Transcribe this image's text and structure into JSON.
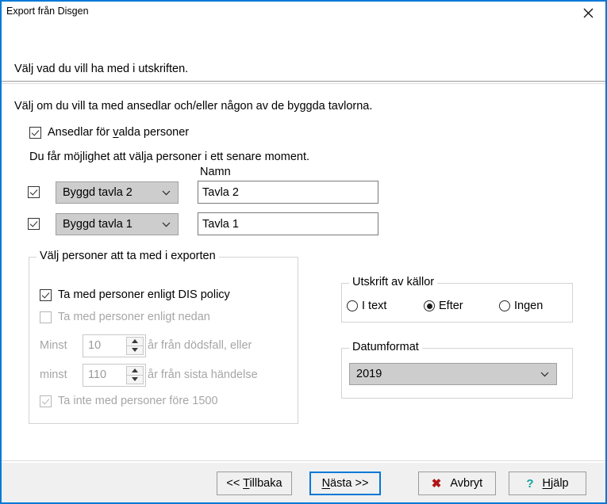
{
  "window": {
    "title": "Export från Disgen",
    "close_icon": "close-icon",
    "border_color": "#0078d7"
  },
  "header": {
    "instruction": "Välj vad du vill ha med i utskriften."
  },
  "main": {
    "intro": "Välj om du vill ta med ansedlar och/eller någon av de byggda tavlorna.",
    "ansedlar_checkbox": {
      "label_pre": "Ansedlar för ",
      "accel": "v",
      "label_post": "alda personer",
      "checked": true
    },
    "note": "Du får möjlighet att välja personer i ett senare moment.",
    "namn_column_label": "Namn",
    "tavlor": [
      {
        "checked": true,
        "combo_value": "Byggd tavla 2",
        "name_value": "Tavla 2"
      },
      {
        "checked": true,
        "combo_value": "Byggd tavla 1",
        "name_value": "Tavla 1"
      }
    ]
  },
  "personer_group": {
    "title": "Välj personer att ta med i exporten",
    "dis_policy": {
      "label": "Ta med personer enligt DIS policy",
      "checked": true,
      "disabled": false
    },
    "enligt_nedan": {
      "label": "Ta med personer enligt nedan",
      "checked": false,
      "disabled": true
    },
    "row1": {
      "prefix": "Minst",
      "value": "10",
      "suffix": "år från dödsfall, eller",
      "disabled": true
    },
    "row2": {
      "prefix": "minst",
      "value": "110",
      "suffix": "år från sista händelse",
      "disabled": true
    },
    "fore_1500": {
      "label": "Ta inte med personer före 1500",
      "checked": true,
      "disabled": true
    }
  },
  "kallor_group": {
    "title": "Utskrift av källor",
    "options": [
      {
        "label": "I text",
        "selected": false
      },
      {
        "label": "Efter",
        "selected": true
      },
      {
        "label": "Ingen",
        "selected": false
      }
    ]
  },
  "datum_group": {
    "title": "Datumformat",
    "selected_value": "2019"
  },
  "footer": {
    "back": {
      "pre": "<< ",
      "accel": "T",
      "post": "illbaka"
    },
    "next": {
      "pre": "",
      "accel": "N",
      "post": "ästa >>",
      "focused": true
    },
    "cancel": {
      "label": "Avbryt",
      "icon": "x-mark-icon",
      "icon_glyph": "✖",
      "icon_color": "#b01515"
    },
    "help": {
      "pre": "",
      "accel": "H",
      "post": "jälp",
      "icon": "question-mark-icon",
      "icon_glyph": "?",
      "icon_color": "#12a0a0"
    }
  }
}
